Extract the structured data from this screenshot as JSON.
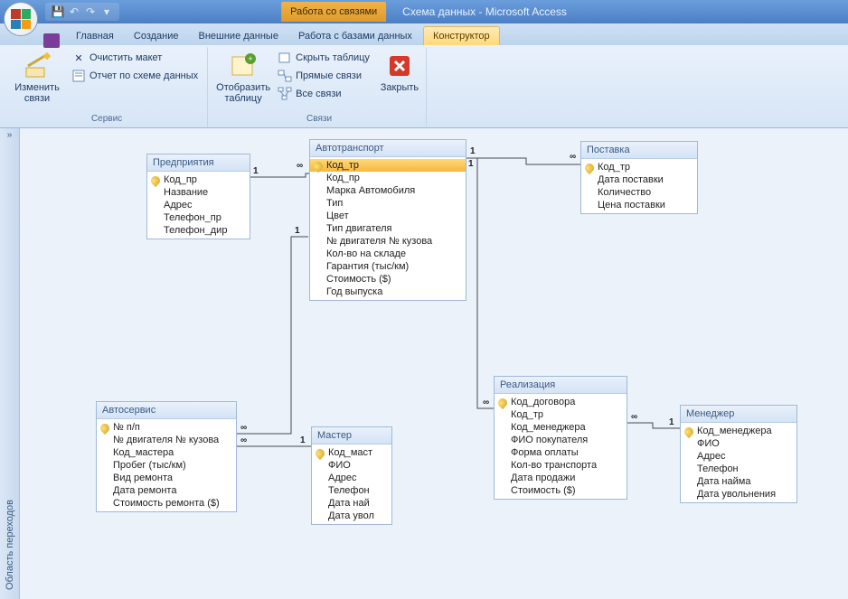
{
  "titlebar": {
    "context_label": "Работа со связями",
    "app_title": "Схема данных - Microsoft Access"
  },
  "tabs": {
    "t0": "Главная",
    "t1": "Создание",
    "t2": "Внешние данные",
    "t3": "Работа с базами данных",
    "t4": "Конструктор"
  },
  "ribbon": {
    "g1": {
      "edit_links": "Изменить связи",
      "clear_layout": "Очистить макет",
      "schema_report": "Отчет по схеме данных",
      "label": "Сервис"
    },
    "g2": {
      "show_table": "Отобразить таблицу",
      "hide_table": "Скрыть таблицу",
      "direct_links": "Прямые связи",
      "all_links": "Все связи",
      "label": "Связи"
    },
    "g3": {
      "close": "Закрыть"
    }
  },
  "nav": {
    "label": "Область переходов"
  },
  "tables": {
    "enterprise": {
      "title": "Предприятия",
      "fields": [
        "Код_пр",
        "Название",
        "Адрес",
        "Телефон_пр",
        "Телефон_дир"
      ]
    },
    "auto": {
      "title": "Автотранспорт",
      "fields": [
        "Код_тр",
        "Код_пр",
        "Марка Автомобиля",
        "Тип",
        "Цвет",
        "Тип двигателя",
        "№ двигателя № кузова",
        "Кол-во на складе",
        "Гарантия  (тыс/км)",
        "Стоимость ($)",
        "Год выпуска"
      ]
    },
    "delivery": {
      "title": "Поставка",
      "fields": [
        "Код_тр",
        "Дата поставки",
        "Количество",
        "Цена поставки"
      ]
    },
    "service": {
      "title": "Автосервис",
      "fields": [
        "№ п/п",
        "№ двигателя № кузова",
        "Код_мастера",
        "Пробег (тыс/км)",
        "Вид ремонта",
        "Дата ремонта",
        "Стоимость ремонта ($)"
      ]
    },
    "master": {
      "title": "Мастер",
      "fields": [
        "Код_маст",
        "ФИО",
        "Адрес",
        "Телефон",
        "Дата най",
        "Дата увол"
      ]
    },
    "sale": {
      "title": "Реализация",
      "fields": [
        "Код_договора",
        "Код_тр",
        "Код_менеджера",
        "ФИО покупателя",
        "Форма оплаты",
        "Кол-во транспорта",
        "Дата продажи",
        "Стоимость ($)"
      ]
    },
    "manager": {
      "title": "Менеджер",
      "fields": [
        "Код_менеджера",
        "ФИО",
        "Адрес",
        "Телефон",
        "Дата найма",
        "Дата увольнения"
      ]
    }
  },
  "rel": {
    "one": "1",
    "inf": "∞"
  }
}
